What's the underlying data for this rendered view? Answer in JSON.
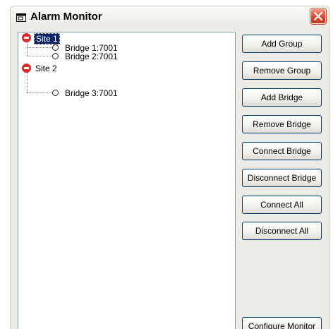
{
  "window": {
    "title": "Alarm Monitor"
  },
  "tree": {
    "sites": [
      {
        "label": "Site 1",
        "selected": true,
        "bridges": [
          "Bridge 1:7001",
          "Bridge 2:7001"
        ]
      },
      {
        "label": "Site 2",
        "selected": false,
        "bridges": [
          "Bridge 3:7001"
        ]
      }
    ]
  },
  "buttons": {
    "add_group": "Add Group",
    "remove_group": "Remove Group",
    "add_bridge": "Add Bridge",
    "remove_bridge": "Remove Bridge",
    "connect_bridge": "Connect Bridge",
    "disconnect_bridge": "Disconnect Bridge",
    "connect_all": "Connect All",
    "disconnect_all": "Disconnect All",
    "configure_monitor": "Configure Monitor"
  },
  "colors": {
    "selection": "#0a246a",
    "site_icon": "#d62b2b",
    "close_button": "#d7492b",
    "button_border": "#003c74"
  },
  "icons": {
    "title": "window-icon",
    "close": "close-icon",
    "site": "site-stop-icon",
    "bridge": "bridge-circle-icon"
  }
}
